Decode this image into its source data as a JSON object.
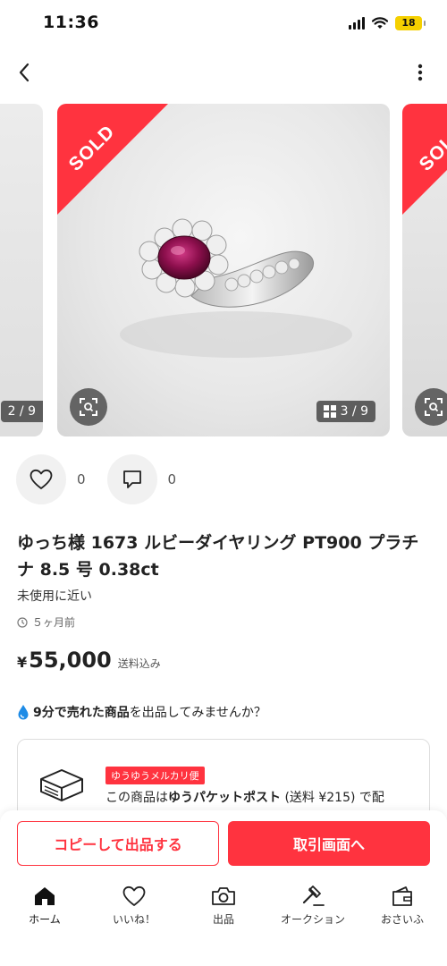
{
  "status_bar": {
    "time": "11:36",
    "battery": "18"
  },
  "carousel": {
    "sold_label": "SOLD",
    "prev_counter": "2 / 9",
    "main_counter": "3 / 9"
  },
  "actions": {
    "like_count": "0",
    "comment_count": "0"
  },
  "product": {
    "title": "ゆっち様 1673 ルビーダイヤリング PT900 プラチナ 8.5 号 0.38ct",
    "condition": "未使用に近い",
    "time_ago": "５ヶ月前",
    "currency": "¥",
    "price": "55,000",
    "shipping_note": "送料込み"
  },
  "promo": {
    "highlight": "9分で売れた商品",
    "rest": "を出品してみませんか？"
  },
  "shipping": {
    "badge": "ゆうゆうメルカリ便",
    "text_prefix": "この商品は",
    "text_bold": "ゆうパケットポスト",
    "text_suffix": " (送料 ¥215) で配"
  },
  "buttons": {
    "copy_label": "コピーして出品する",
    "trade_label": "取引画面へ"
  },
  "tabs": [
    {
      "label": "ホーム",
      "icon": "home-icon"
    },
    {
      "label": "いいね！",
      "icon": "heart-icon"
    },
    {
      "label": "出品",
      "icon": "camera-icon"
    },
    {
      "label": "オークション",
      "icon": "gavel-icon"
    },
    {
      "label": "おさいふ",
      "icon": "wallet-icon"
    }
  ],
  "colors": {
    "accent": "#ff333f",
    "battery": "#f5d000"
  }
}
